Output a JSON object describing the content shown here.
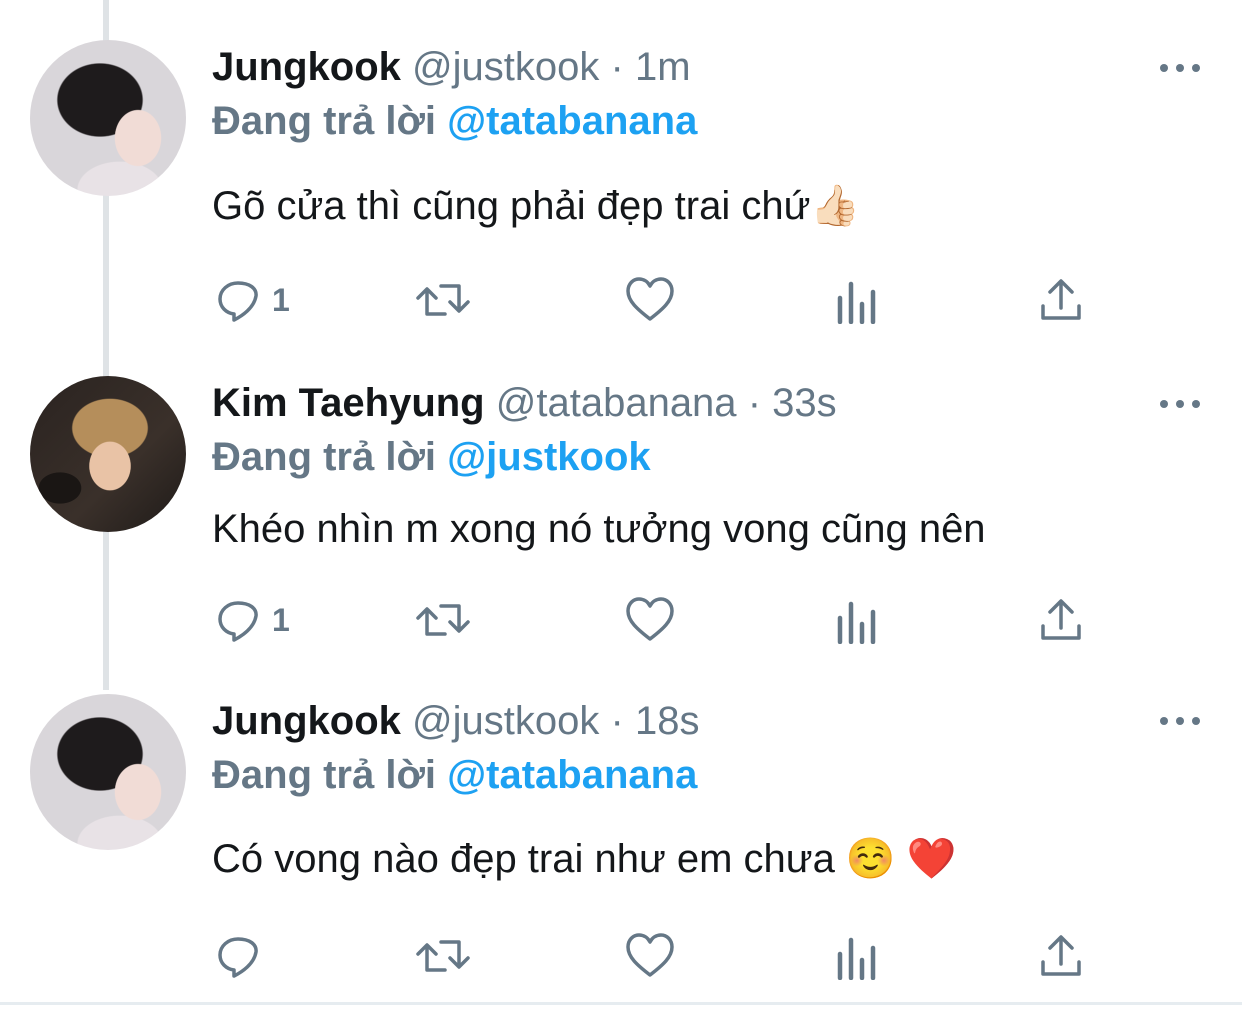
{
  "tweets": [
    {
      "name": "Jungkook",
      "handle": "@justkook",
      "separator": "·",
      "time": "1m",
      "reply_prefix": "Đang trả lời",
      "reply_to": "@tatabanana",
      "text": "Gõ cửa thì cũng phải đẹp trai chứ👍🏻",
      "reply_count": "1",
      "avatar": "jungkook-avatar"
    },
    {
      "name": "Kim Taehyung",
      "handle": "@tatabanana",
      "separator": "·",
      "time": "33s",
      "reply_prefix": "Đang trả lời",
      "reply_to": "@justkook",
      "text": "Khéo nhìn m xong nó tưởng vong cũng nên",
      "reply_count": "1",
      "avatar": "taehyung-avatar"
    },
    {
      "name": "Jungkook",
      "handle": "@justkook",
      "separator": "·",
      "time": "18s",
      "reply_prefix": "Đang trả lời",
      "reply_to": "@tatabanana",
      "text": "Có vong nào đẹp trai như em chưa ☺️ ❤️",
      "reply_count": "",
      "avatar": "jungkook-avatar"
    }
  ],
  "icons": {
    "reply": "reply-icon",
    "retweet": "retweet-icon",
    "like": "like-icon",
    "analytics": "analytics-icon",
    "share": "share-icon",
    "more": "more-icon"
  },
  "colors": {
    "accent": "#1da1f2",
    "secondary_text": "#657786",
    "primary_text": "#14171a",
    "thread_line": "#dfe3e6"
  }
}
